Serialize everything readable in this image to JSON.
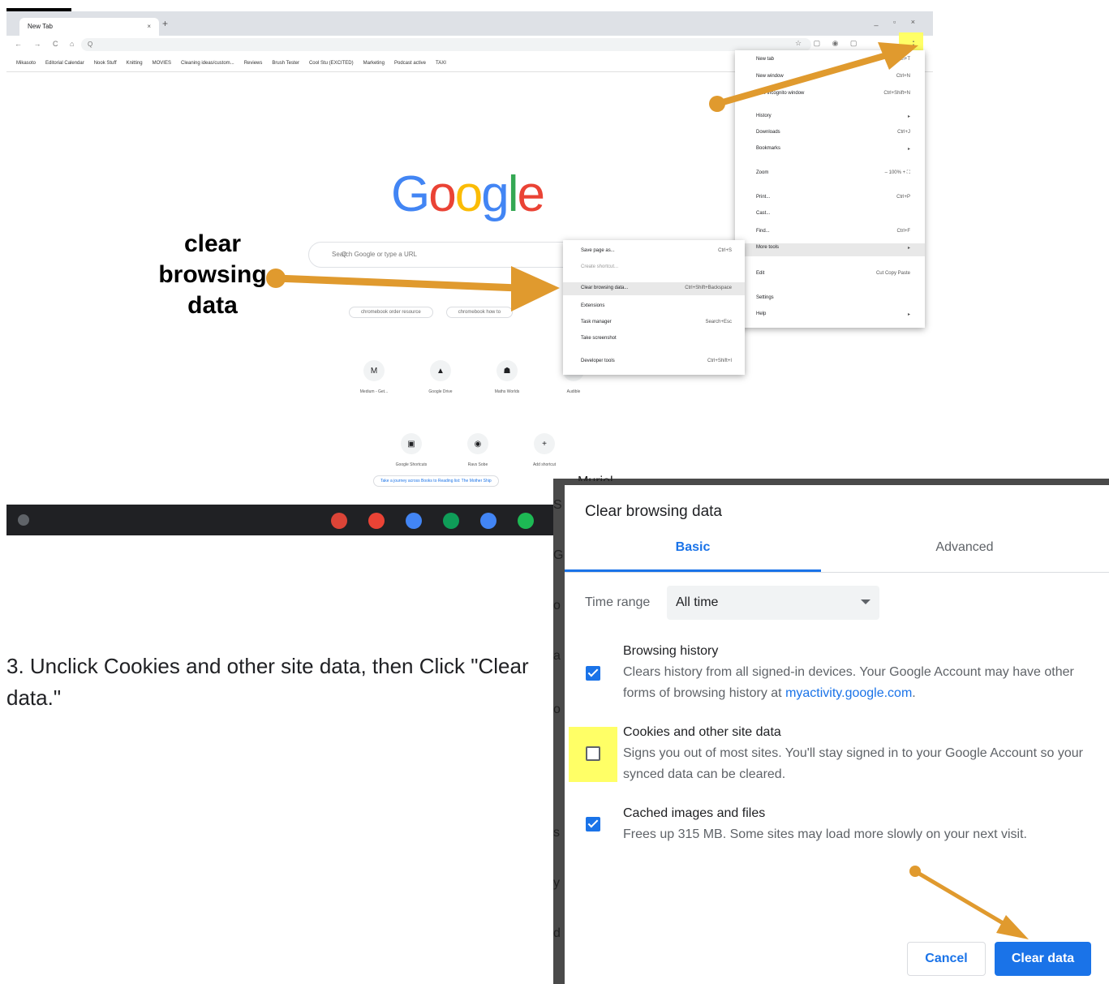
{
  "browser": {
    "tab_title": "New Tab",
    "tab_close": "×",
    "new_tab": "+",
    "window_controls": "_ ▫ ×",
    "nav_buttons": "← → C ⌂",
    "omnibox_text": "Q",
    "extensions": "☆ ▢ ◉ ▢",
    "bookmarks": [
      "Mikasoto",
      "Editorial Calendar",
      "Nook Stuff",
      "Knitting",
      "MOVIES",
      "Cleaning ideas/custom...",
      "Reviews",
      "Brush Tester",
      "Cool Stu (EXCITED)",
      "Marketing",
      "Podcast active",
      "TAXI"
    ],
    "logo_letters": [
      {
        "ch": "G",
        "color": "#4285f4"
      },
      {
        "ch": "o",
        "color": "#ea4335"
      },
      {
        "ch": "o",
        "color": "#fbbc05"
      },
      {
        "ch": "g",
        "color": "#4285f4"
      },
      {
        "ch": "l",
        "color": "#34a853"
      },
      {
        "ch": "e",
        "color": "#ea4335"
      }
    ],
    "search_placeholder": "Search Google or type a URL",
    "search_icon": "Q",
    "chips": [
      "chromebook order resource",
      "chromebook how to"
    ],
    "shortcuts_row1": [
      {
        "icon": "M",
        "label": "Medium - Get..."
      },
      {
        "icon": "▲",
        "label": "Google Drive"
      },
      {
        "icon": "☗",
        "label": "Maths Worlds"
      },
      {
        "icon": "▮",
        "label": "Audible"
      }
    ],
    "shortcuts_row2": [
      {
        "icon": "▣",
        "label": "Google Shortcuts"
      },
      {
        "icon": "◉",
        "label": "Ravs Sobe"
      },
      {
        "icon": "+",
        "label": "Add shortcut"
      }
    ],
    "promo": "Take a journey across Books to Reading list: The Mother Ship",
    "taskbar_apps": [
      "#db4437",
      "#ea4335",
      "#4285f4",
      "#0f9d58",
      "#4285f4",
      "#1db954",
      "#fbbc05"
    ],
    "kebab": "⋮"
  },
  "main_menu": [
    {
      "label": "New tab",
      "shortcut": "Ctrl+T"
    },
    {
      "label": "New window",
      "shortcut": "Ctrl+N"
    },
    {
      "label": "New incognito window",
      "shortcut": "Ctrl+Shift+N"
    },
    {
      "label": "History",
      "shortcut": "▸"
    },
    {
      "label": "Downloads",
      "shortcut": "Ctrl+J"
    },
    {
      "label": "Bookmarks",
      "shortcut": "▸"
    },
    {
      "label": "Zoom",
      "shortcut": "–   100%   +     ⛶"
    },
    {
      "label": "Print...",
      "shortcut": "Ctrl+P"
    },
    {
      "label": "Cast...",
      "shortcut": ""
    },
    {
      "label": "Find...",
      "shortcut": "Ctrl+F"
    },
    {
      "label": "More tools",
      "shortcut": "▸"
    },
    {
      "label": "Edit",
      "shortcut": "Cut      Copy      Paste"
    },
    {
      "label": "Settings",
      "shortcut": ""
    },
    {
      "label": "Help",
      "shortcut": "▸"
    }
  ],
  "sub_menu": [
    {
      "label": "Save page as...",
      "shortcut": "Ctrl+S"
    },
    {
      "label": "Create shortcut...",
      "shortcut": ""
    },
    {
      "label": "Clear browsing data...",
      "shortcut": "Ctrl+Shift+Backspace"
    },
    {
      "label": "Extensions",
      "shortcut": ""
    },
    {
      "label": "Task manager",
      "shortcut": "Search+Esc"
    },
    {
      "label": "Take screenshot",
      "shortcut": ""
    },
    {
      "label": "Developer tools",
      "shortcut": "Ctrl+Shift+I"
    }
  ],
  "annotation": {
    "label_lines": [
      "clear",
      "browsing",
      "data"
    ],
    "instruction": "3. Unclick Cookies and other site data, then Click \"Clear data.\"",
    "arrow_color": "#e09a2e",
    "highlight_color": "#ffff66"
  },
  "bg_fragments": [
    "Muriel Sobel",
    "S",
    "G",
    "o",
    "a",
    "o",
    "s",
    "y",
    "d"
  ],
  "dialog": {
    "title": "Clear browsing data",
    "tabs": [
      "Basic",
      "Advanced"
    ],
    "active_tab": "Basic",
    "time_range_label": "Time range",
    "time_range_value": "All time",
    "options": [
      {
        "title": "Browsing history",
        "desc": "Clears history from all signed-in devices. Your Google Account may have other forms of browsing history at ",
        "link": "myactivity.google.com",
        "desc_end": ".",
        "checked": true
      },
      {
        "title": "Cookies and other site data",
        "desc": "Signs you out of most sites. You'll stay signed in to your Google Account so your synced data can be cleared.",
        "checked": false
      },
      {
        "title": "Cached images and files",
        "desc": "Frees up 315 MB. Some sites may load more slowly on your next visit.",
        "checked": true
      }
    ],
    "cancel_label": "Cancel",
    "clear_label": "Clear data",
    "accent": "#1a73e8"
  }
}
